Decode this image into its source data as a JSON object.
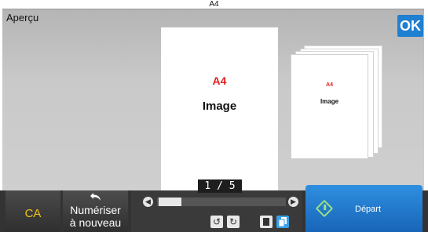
{
  "header": {
    "title": "Aperçu",
    "paper_size": "A4",
    "ok_label": "OK"
  },
  "preview": {
    "main_page": {
      "size_label": "A4",
      "content_label": "Image"
    },
    "thumbnail": {
      "size_label": "A4",
      "content_label": "Image"
    },
    "page_counter": "1 / 5"
  },
  "footer": {
    "ca_label": "CA",
    "rescan_label_line1": "Numériser",
    "rescan_label_line2": "à nouveau",
    "start_label": "Départ"
  },
  "navigation": {
    "scroll_position_fraction": 0.0
  },
  "icons": {
    "rescan": "undo-arrow-icon",
    "start": "start-diamond-icon",
    "rotate_left": "rotate-left-icon",
    "rotate_right": "rotate-right-icon",
    "view_single": "single-page-view-icon",
    "view_multi": "multi-page-view-icon"
  },
  "colors": {
    "ok_button": "#1f7fd1",
    "start_button": "#1f78d1",
    "ca_text": "#f0c419",
    "size_label": "#e02020"
  }
}
